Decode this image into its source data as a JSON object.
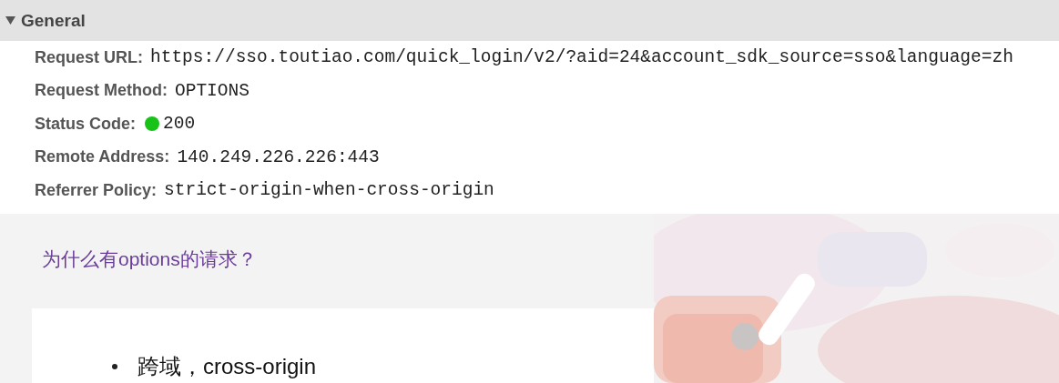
{
  "general": {
    "title": "General",
    "expanded": true,
    "fields": [
      {
        "label": "Request URL:",
        "value": "https://sso.toutiao.com/quick_login/v2/?aid=24&account_sdk_source=sso&language=zh"
      },
      {
        "label": "Request Method:",
        "value": "OPTIONS"
      },
      {
        "label": "Status Code:",
        "value": "200",
        "color": "#19c219"
      },
      {
        "label": "Remote Address:",
        "value": "140.249.226.226:443"
      },
      {
        "label": "Referrer Policy:",
        "value": "strict-origin-when-cross-origin"
      }
    ]
  },
  "article": {
    "heading": "为什么有options的请求？",
    "bullets": [
      "跨域，cross-origin"
    ]
  }
}
